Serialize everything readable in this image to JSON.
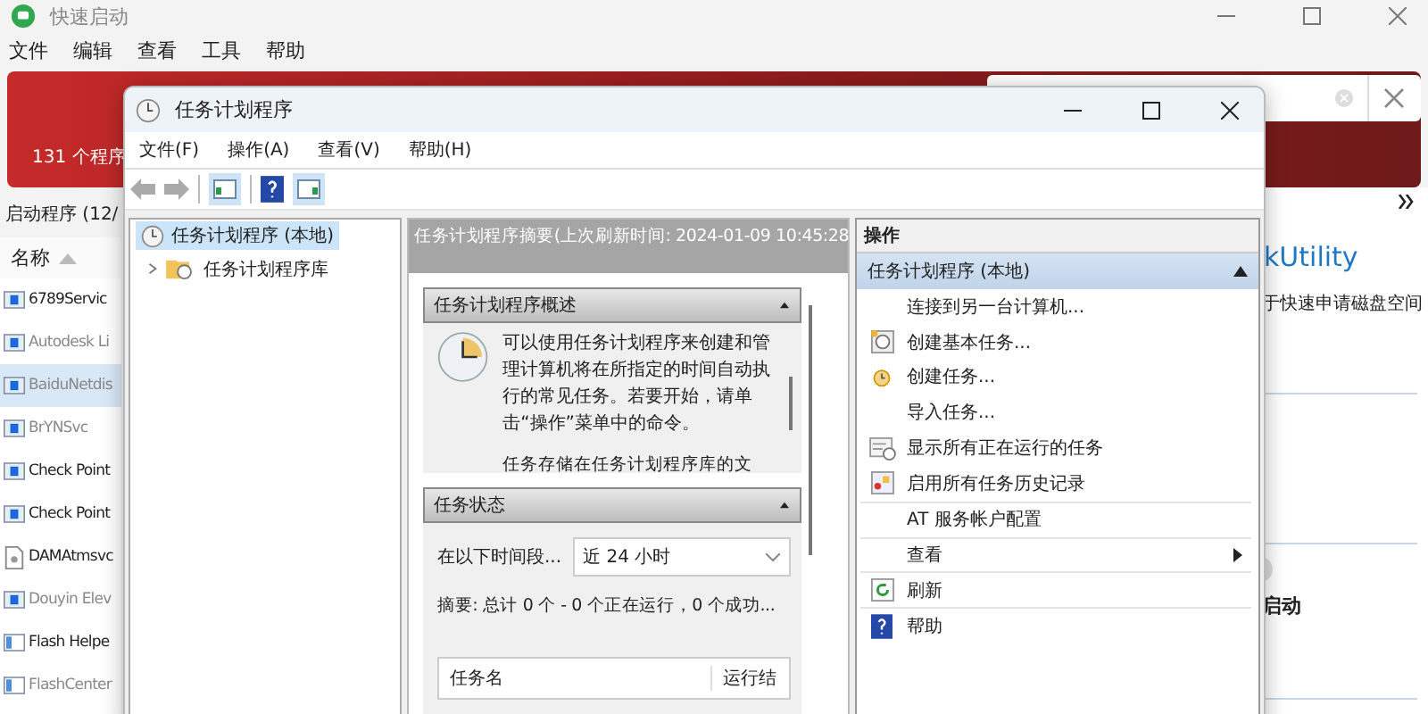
{
  "app": {
    "title": "快速启动",
    "menu": [
      "文件",
      "编辑",
      "查看",
      "工具",
      "帮助"
    ],
    "banner_text": "131 个程序",
    "list_title": "启动程序 (12/",
    "column": "名称",
    "rows": [
      {
        "name": "6789Servic",
        "disabled": false,
        "selected": false
      },
      {
        "name": "Autodesk Li",
        "disabled": true,
        "selected": false
      },
      {
        "name": "BaiduNetdis",
        "disabled": true,
        "selected": true
      },
      {
        "name": "BrYNSvc",
        "disabled": true,
        "selected": false
      },
      {
        "name": "Check Point",
        "disabled": false,
        "selected": false
      },
      {
        "name": "Check Point",
        "disabled": false,
        "selected": false
      },
      {
        "name": "DAMAtmsvc",
        "disabled": false,
        "selected": false,
        "kind": "file"
      },
      {
        "name": "Douyin Elev",
        "disabled": true,
        "selected": false
      },
      {
        "name": "Flash Helpe",
        "disabled": false,
        "selected": false,
        "kind": "panel"
      },
      {
        "name": "FlashCenter",
        "disabled": true,
        "selected": false,
        "kind": "panel"
      }
    ],
    "detail": {
      "heading": "kUtility",
      "description": "于快速申请磁盘空间",
      "toggle_on": false,
      "toggle_label": "启动"
    }
  },
  "scheduler": {
    "title": "任务计划程序",
    "menu": [
      "文件(F)",
      "操作(A)",
      "查看(V)",
      "帮助(H)"
    ],
    "tree": [
      {
        "label": "任务计划程序 (本地)",
        "selected": true,
        "children": [
          {
            "label": "任务计划程序库",
            "selected": false,
            "expanded": false
          }
        ]
      }
    ],
    "summary": {
      "header": "任务计划程序摘要(上次刷新时间: 2024-01-09 10:45:28",
      "overview": {
        "title": "任务计划程序概述",
        "text": "可以使用任务计划程序来创建和管理计算机将在所指定的时间自动执行的常见任务。若要开始，请单击“操作”菜单中的命令。",
        "text_2": "任务存储在任务计划程序库的文"
      },
      "status": {
        "title": "任务状态",
        "period_label": "在以下时间段...",
        "period": "近 24 小时",
        "summary": "摘要: 总计 0 个 - 0 个正在运行，0 个成功...",
        "columns": [
          "任务名",
          "运行结"
        ]
      }
    },
    "actions": {
      "title": "操作",
      "group": "任务计划程序 (本地)",
      "items": [
        {
          "label": "连接到另一台计算机...",
          "kind": "plain",
          "separator": false
        },
        {
          "label": "创建基本任务...",
          "kind": "basic",
          "separator": false
        },
        {
          "label": "创建任务...",
          "kind": "task",
          "separator": false
        },
        {
          "label": "导入任务...",
          "kind": "plain",
          "separator": false
        },
        {
          "label": "显示所有正在运行的任务",
          "kind": "running",
          "separator": false
        },
        {
          "label": "启用所有任务历史记录",
          "kind": "history",
          "separator": false
        },
        {
          "label": "AT 服务帐户配置",
          "kind": "plain",
          "separator": true
        },
        {
          "label": "查看",
          "kind": "submenu",
          "separator": true
        },
        {
          "label": "刷新",
          "kind": "refresh",
          "separator": true
        },
        {
          "label": "帮助",
          "kind": "help",
          "separator": true
        }
      ]
    }
  }
}
